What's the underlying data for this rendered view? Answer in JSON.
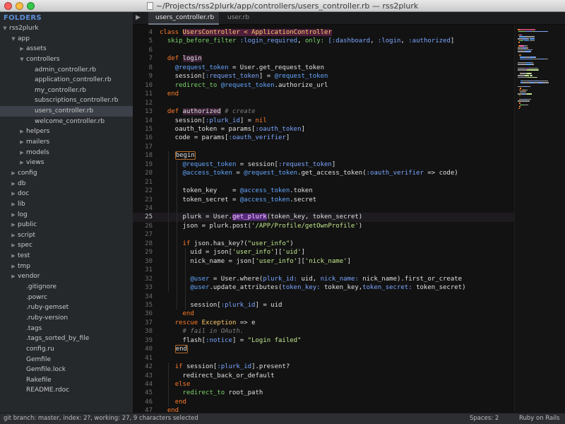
{
  "window": {
    "title": "~/Projects/rss2plurk/app/controllers/users_controller.rb — rss2plurk"
  },
  "sidebar": {
    "header": "FOLDERS",
    "tree": [
      {
        "label": "rss2plurk",
        "depth": 0,
        "arrow": "open"
      },
      {
        "label": "app",
        "depth": 1,
        "arrow": "open"
      },
      {
        "label": "assets",
        "depth": 2,
        "arrow": "closed"
      },
      {
        "label": "controllers",
        "depth": 2,
        "arrow": "open"
      },
      {
        "label": "admin_controller.rb",
        "depth": 3,
        "arrow": "none"
      },
      {
        "label": "application_controller.rb",
        "depth": 3,
        "arrow": "none"
      },
      {
        "label": "my_controller.rb",
        "depth": 3,
        "arrow": "none"
      },
      {
        "label": "subscriptions_controller.rb",
        "depth": 3,
        "arrow": "none"
      },
      {
        "label": "users_controller.rb",
        "depth": 3,
        "arrow": "none",
        "selected": true
      },
      {
        "label": "welcome_controller.rb",
        "depth": 3,
        "arrow": "none"
      },
      {
        "label": "helpers",
        "depth": 2,
        "arrow": "closed"
      },
      {
        "label": "mailers",
        "depth": 2,
        "arrow": "closed"
      },
      {
        "label": "models",
        "depth": 2,
        "arrow": "closed"
      },
      {
        "label": "views",
        "depth": 2,
        "arrow": "closed"
      },
      {
        "label": "config",
        "depth": 1,
        "arrow": "closed"
      },
      {
        "label": "db",
        "depth": 1,
        "arrow": "closed"
      },
      {
        "label": "doc",
        "depth": 1,
        "arrow": "closed"
      },
      {
        "label": "lib",
        "depth": 1,
        "arrow": "closed"
      },
      {
        "label": "log",
        "depth": 1,
        "arrow": "closed"
      },
      {
        "label": "public",
        "depth": 1,
        "arrow": "closed"
      },
      {
        "label": "script",
        "depth": 1,
        "arrow": "closed"
      },
      {
        "label": "spec",
        "depth": 1,
        "arrow": "closed"
      },
      {
        "label": "test",
        "depth": 1,
        "arrow": "closed"
      },
      {
        "label": "tmp",
        "depth": 1,
        "arrow": "closed"
      },
      {
        "label": "vendor",
        "depth": 1,
        "arrow": "closed"
      },
      {
        "label": ".gitignore",
        "depth": 2,
        "arrow": "none"
      },
      {
        "label": ".powrc",
        "depth": 2,
        "arrow": "none"
      },
      {
        "label": ".ruby-gemset",
        "depth": 2,
        "arrow": "none"
      },
      {
        "label": ".ruby-version",
        "depth": 2,
        "arrow": "none"
      },
      {
        "label": ".tags",
        "depth": 2,
        "arrow": "none"
      },
      {
        "label": ".tags_sorted_by_file",
        "depth": 2,
        "arrow": "none"
      },
      {
        "label": "config.ru",
        "depth": 2,
        "arrow": "none"
      },
      {
        "label": "Gemfile",
        "depth": 2,
        "arrow": "none"
      },
      {
        "label": "Gemfile.lock",
        "depth": 2,
        "arrow": "none"
      },
      {
        "label": "Rakefile",
        "depth": 2,
        "arrow": "none"
      },
      {
        "label": "README.rdoc",
        "depth": 2,
        "arrow": "none"
      }
    ]
  },
  "tabs": [
    {
      "label": "users_controller.rb",
      "active": true
    },
    {
      "label": "user.rb",
      "active": false
    }
  ],
  "editor": {
    "current_line": 25,
    "lines": [
      {
        "n": 4,
        "segs": [
          [
            "kw",
            "class "
          ],
          [
            "clsbox",
            "UsersController < ApplicationController"
          ]
        ]
      },
      {
        "n": 5,
        "segs": [
          [
            "",
            "  "
          ],
          [
            "grn",
            "skip_before_filter"
          ],
          [
            "sym",
            " :login_required"
          ],
          [
            "",
            ", "
          ],
          [
            "grn",
            "only:"
          ],
          [
            "",
            ""
          ],
          [
            "sym",
            " [:dashboard"
          ],
          [
            "",
            ", "
          ],
          [
            "sym",
            ":login"
          ],
          [
            "",
            ", "
          ],
          [
            "sym",
            ":authorized"
          ],
          [
            "",
            "]"
          ]
        ]
      },
      {
        "n": 6,
        "segs": []
      },
      {
        "n": 7,
        "segs": [
          [
            "",
            "  "
          ],
          [
            "kw",
            "def "
          ],
          [
            "fnbox",
            "login"
          ]
        ]
      },
      {
        "n": 8,
        "segs": [
          [
            "",
            "    "
          ],
          [
            "ivar",
            "@request_token"
          ],
          [
            "",
            " = User.get_request_token"
          ]
        ]
      },
      {
        "n": 9,
        "segs": [
          [
            "",
            "    session["
          ],
          [
            "sym",
            ":request_token"
          ],
          [
            "",
            "] = "
          ],
          [
            "ivar",
            "@request_token"
          ]
        ]
      },
      {
        "n": 10,
        "segs": [
          [
            "",
            "    "
          ],
          [
            "grn",
            "redirect_to"
          ],
          [
            "",
            " "
          ],
          [
            "ivar",
            "@request_token"
          ],
          [
            "",
            ".authorize_url"
          ]
        ]
      },
      {
        "n": 11,
        "segs": [
          [
            "",
            "  "
          ],
          [
            "kw",
            "end"
          ]
        ]
      },
      {
        "n": 12,
        "segs": []
      },
      {
        "n": 13,
        "segs": [
          [
            "",
            "  "
          ],
          [
            "kw",
            "def "
          ],
          [
            "fnbox",
            "authorized"
          ],
          [
            "",
            " "
          ],
          [
            "cmt",
            "# create"
          ]
        ]
      },
      {
        "n": 14,
        "segs": [
          [
            "",
            "    session["
          ],
          [
            "sym",
            ":plurk_id"
          ],
          [
            "",
            "] = "
          ],
          [
            "kw",
            "nil"
          ]
        ]
      },
      {
        "n": 15,
        "segs": [
          [
            "",
            "    oauth_token = params["
          ],
          [
            "sym",
            ":oauth_token"
          ],
          [
            "",
            "]"
          ]
        ]
      },
      {
        "n": 16,
        "segs": [
          [
            "",
            "    code = params["
          ],
          [
            "sym",
            ":oauth_verifier"
          ],
          [
            "",
            "]"
          ]
        ]
      },
      {
        "n": 17,
        "segs": []
      },
      {
        "n": 18,
        "segs": [
          [
            "",
            "    "
          ],
          [
            "begbox",
            "begin"
          ]
        ]
      },
      {
        "n": 19,
        "segs": [
          [
            "",
            "      "
          ],
          [
            "ivar",
            "@request_token"
          ],
          [
            "",
            " = session["
          ],
          [
            "sym",
            ":request_token"
          ],
          [
            "",
            "]"
          ]
        ]
      },
      {
        "n": 20,
        "segs": [
          [
            "",
            "      "
          ],
          [
            "ivar",
            "@access_token"
          ],
          [
            "",
            " = "
          ],
          [
            "ivar",
            "@request_token"
          ],
          [
            "",
            ".get_access_token("
          ],
          [
            "sym",
            ":oauth_verifier"
          ],
          [
            "",
            " => code)"
          ]
        ]
      },
      {
        "n": 21,
        "segs": []
      },
      {
        "n": 22,
        "segs": [
          [
            "",
            "      token_key    = "
          ],
          [
            "ivar",
            "@access_token"
          ],
          [
            "",
            ".token"
          ]
        ]
      },
      {
        "n": 23,
        "segs": [
          [
            "",
            "      token_secret = "
          ],
          [
            "ivar",
            "@access_token"
          ],
          [
            "",
            ".secret"
          ]
        ]
      },
      {
        "n": 24,
        "segs": []
      },
      {
        "n": 25,
        "segs": [
          [
            "",
            "      plurk = User."
          ],
          [
            "hlbox",
            "get_plurk"
          ],
          [
            "",
            "(token_key, token_secret)"
          ]
        ]
      },
      {
        "n": 26,
        "segs": [
          [
            "",
            "      json = plurk.post("
          ],
          [
            "str",
            "'/APP/Profile/getOwnProfile'"
          ],
          [
            "",
            ")"
          ]
        ]
      },
      {
        "n": 27,
        "segs": []
      },
      {
        "n": 28,
        "segs": [
          [
            "",
            "      "
          ],
          [
            "kw",
            "if"
          ],
          [
            "",
            " json.has_key?("
          ],
          [
            "str",
            "\"user_info\""
          ],
          [
            "",
            ")"
          ]
        ]
      },
      {
        "n": 29,
        "segs": [
          [
            "",
            "        uid = json["
          ],
          [
            "str",
            "'user_info'"
          ],
          [
            "",
            "]["
          ],
          [
            "str",
            "'uid'"
          ],
          [
            "",
            "]"
          ]
        ]
      },
      {
        "n": 30,
        "segs": [
          [
            "",
            "        nick_name = json["
          ],
          [
            "str",
            "'user_info'"
          ],
          [
            "",
            "]["
          ],
          [
            "str",
            "'nick_name'"
          ],
          [
            "",
            "]"
          ]
        ]
      },
      {
        "n": 31,
        "segs": []
      },
      {
        "n": 32,
        "segs": [
          [
            "",
            "        "
          ],
          [
            "ivar",
            "@user"
          ],
          [
            "",
            " = User.where("
          ],
          [
            "sym",
            "plurk_id:"
          ],
          [
            "",
            " uid, "
          ],
          [
            "sym",
            "nick_name:"
          ],
          [
            "",
            " nick_name).first_or_create"
          ]
        ]
      },
      {
        "n": 33,
        "segs": [
          [
            "",
            "        "
          ],
          [
            "ivar",
            "@user"
          ],
          [
            "",
            ".update_attributes("
          ],
          [
            "sym",
            "token_key:"
          ],
          [
            "",
            " token_key,"
          ],
          [
            "sym",
            "token_secret:"
          ],
          [
            "",
            " token_secret)"
          ]
        ]
      },
      {
        "n": 34,
        "segs": []
      },
      {
        "n": 35,
        "segs": [
          [
            "",
            "        session["
          ],
          [
            "sym",
            ":plurk_id"
          ],
          [
            "",
            "] = uid"
          ]
        ]
      },
      {
        "n": 36,
        "segs": [
          [
            "",
            "      "
          ],
          [
            "kw",
            "end"
          ]
        ]
      },
      {
        "n": 37,
        "segs": [
          [
            "",
            "    "
          ],
          [
            "kw",
            "rescue"
          ],
          [
            "",
            " "
          ],
          [
            "cls",
            "Exception"
          ],
          [
            "",
            " => e"
          ]
        ]
      },
      {
        "n": 38,
        "segs": [
          [
            "",
            "      "
          ],
          [
            "cmt",
            "# fail in OAuth."
          ]
        ]
      },
      {
        "n": 39,
        "segs": [
          [
            "",
            "      flash["
          ],
          [
            "sym",
            ":notice"
          ],
          [
            "",
            "] = "
          ],
          [
            "str",
            "\"Login failed\""
          ]
        ]
      },
      {
        "n": 40,
        "segs": [
          [
            "",
            "    "
          ],
          [
            "begbox",
            "end"
          ]
        ]
      },
      {
        "n": 41,
        "segs": []
      },
      {
        "n": 42,
        "segs": [
          [
            "",
            "    "
          ],
          [
            "kw",
            "if"
          ],
          [
            "",
            " session["
          ],
          [
            "sym",
            ":plurk_id"
          ],
          [
            "",
            "].present?"
          ]
        ]
      },
      {
        "n": 43,
        "segs": [
          [
            "",
            "      redirect_back_or_default"
          ]
        ]
      },
      {
        "n": 44,
        "segs": [
          [
            "",
            "    "
          ],
          [
            "kw",
            "else"
          ]
        ]
      },
      {
        "n": 45,
        "segs": [
          [
            "",
            "      "
          ],
          [
            "grn",
            "redirect_to"
          ],
          [
            "",
            " root_path"
          ]
        ]
      },
      {
        "n": 46,
        "segs": [
          [
            "",
            "    "
          ],
          [
            "kw",
            "end"
          ]
        ]
      },
      {
        "n": 47,
        "segs": [
          [
            "",
            "  "
          ],
          [
            "kw",
            "end"
          ]
        ]
      }
    ]
  },
  "status": {
    "left": "git branch: master, index: 2?, working: 27, 9 characters selected",
    "spaces": "Spaces: 2",
    "syntax": "Ruby on Rails"
  }
}
